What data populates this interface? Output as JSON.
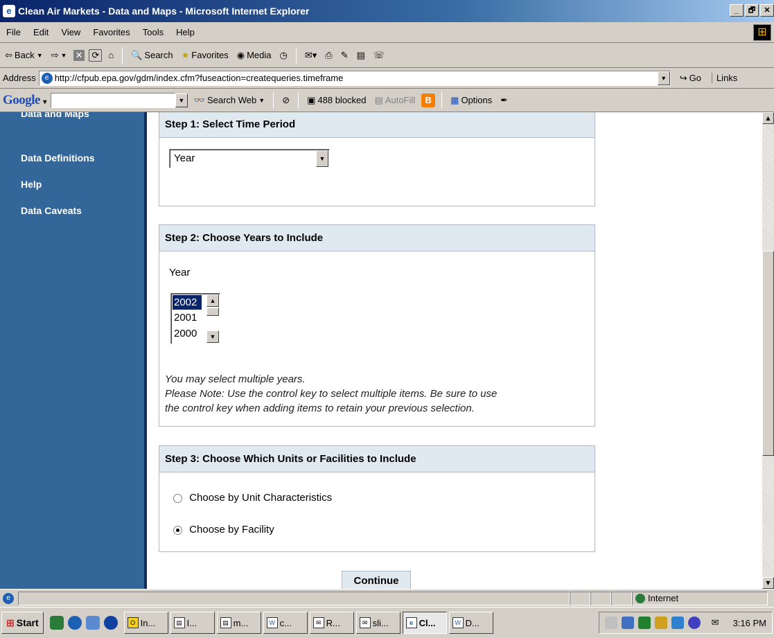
{
  "window": {
    "title": "Clean Air Markets - Data and Maps - Microsoft Internet Explorer",
    "buttons": [
      "_",
      "🗗",
      "✕"
    ]
  },
  "menu": [
    "File",
    "Edit",
    "View",
    "Favorites",
    "Tools",
    "Help"
  ],
  "toolbar": {
    "back": "Back",
    "search": "Search",
    "favorites": "Favorites",
    "media": "Media"
  },
  "address": {
    "label": "Address",
    "url": "http://cfpub.epa.gov/gdm/index.cfm?fuseaction=createqueries.timeframe",
    "go": "Go",
    "links": "Links"
  },
  "google": {
    "logo": "Google",
    "search_web": "Search Web",
    "blocked": "488 blocked",
    "autofill": "AutoFill",
    "options": "Options"
  },
  "sidebar": {
    "items": [
      "Data and Maps",
      "Data Definitions",
      "Help",
      "Data Caveats"
    ]
  },
  "step1": {
    "title": "Step 1: Select Time Period",
    "selected": "Year"
  },
  "step2": {
    "title": "Step 2: Choose Years to Include",
    "label": "Year",
    "options": [
      "2002",
      "2001",
      "2000"
    ],
    "note1": "You may select multiple years.",
    "note2": "Please Note: Use the control key to select multiple items. Be sure to use",
    "note3": "the control key when adding items to retain your previous selection."
  },
  "step3": {
    "title": "Step 3: Choose Which Units or Facilities to Include",
    "option1": "Choose by Unit Characteristics",
    "option2": "Choose by Facility",
    "selected_option": "Choose by Facility"
  },
  "continue_label": "Continue",
  "status": {
    "zone": "Internet"
  },
  "taskbar": {
    "start": "Start",
    "buttons": [
      "In...",
      "I...",
      "m...",
      "c...",
      "R...",
      "sli...",
      "Cl...",
      "D..."
    ],
    "active": "Cl...",
    "time": "3:16 PM"
  },
  "colors": {
    "sidebar_bg": "#336699",
    "panel_header_bg": "#e0e8f0",
    "titlebar_start": "#0a246a"
  }
}
